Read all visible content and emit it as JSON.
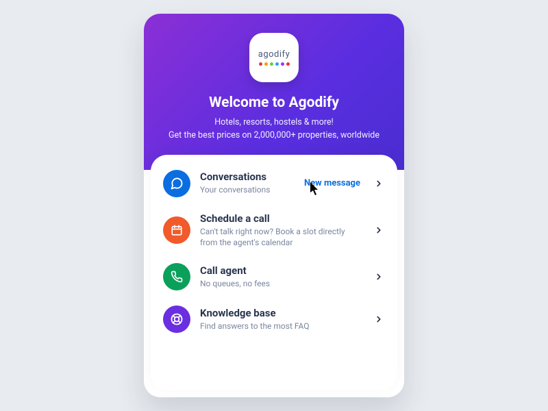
{
  "logo": {
    "wordmark": "agodify"
  },
  "header": {
    "title": "Welcome to Agodify",
    "subtitle_line1": "Hotels, resorts, hostels & more!",
    "subtitle_line2": "Get the best prices on 2,000,000+ properties, worldwide"
  },
  "options": [
    {
      "icon": "chat-icon",
      "title": "Conversations",
      "subtitle": "Your conversations",
      "cta": "New message"
    },
    {
      "icon": "calendar-icon",
      "title": "Schedule a call",
      "subtitle": "Can't talk right now? Book a slot directly from the agent's calendar",
      "cta": ""
    },
    {
      "icon": "phone-icon",
      "title": "Call agent",
      "subtitle": "No queues, no fees",
      "cta": ""
    },
    {
      "icon": "lifebuoy-icon",
      "title": "Knowledge base",
      "subtitle": "Find answers to the most FAQ",
      "cta": ""
    }
  ],
  "colors": {
    "accent_blue": "#0a6ee0",
    "accent_orange": "#f15a2b",
    "accent_green": "#0aa05a",
    "accent_purple": "#6a2fe0",
    "gradient_start": "#8b2fd6",
    "gradient_end": "#4a2dd0"
  }
}
